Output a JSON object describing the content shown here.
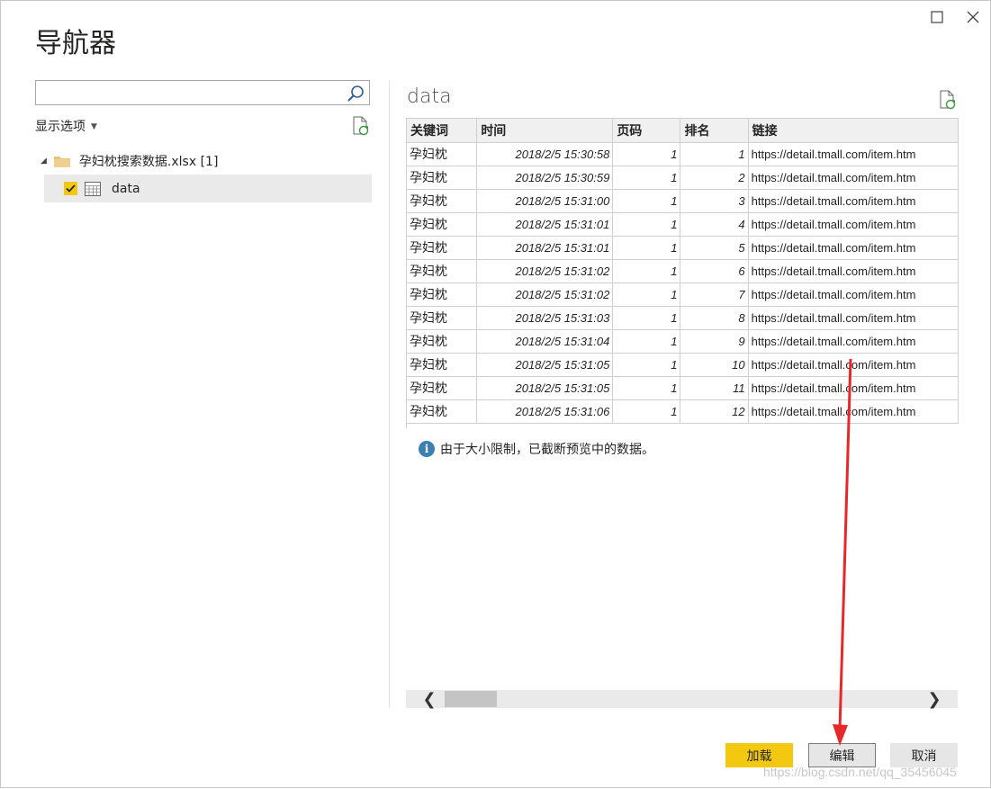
{
  "window": {
    "title": "导航器",
    "maximize_icon": "maximize-icon",
    "close_icon": "close-icon"
  },
  "left_panel": {
    "search": {
      "value": "",
      "placeholder": ""
    },
    "display_options_label": "显示选项",
    "tree": {
      "file_name": "孕妇枕搜索数据.xlsx [1]",
      "items": [
        {
          "label": "data",
          "checked": true
        }
      ]
    }
  },
  "preview": {
    "title": "data",
    "columns": [
      "关键词",
      "时间",
      "页码",
      "排名",
      "链接"
    ],
    "rows": [
      [
        "孕妇枕",
        "2018/2/5 15:30:58",
        "1",
        "1",
        "https://detail.tmall.com/item.htm"
      ],
      [
        "孕妇枕",
        "2018/2/5 15:30:59",
        "1",
        "2",
        "https://detail.tmall.com/item.htm"
      ],
      [
        "孕妇枕",
        "2018/2/5 15:31:00",
        "1",
        "3",
        "https://detail.tmall.com/item.htm"
      ],
      [
        "孕妇枕",
        "2018/2/5 15:31:01",
        "1",
        "4",
        "https://detail.tmall.com/item.htm"
      ],
      [
        "孕妇枕",
        "2018/2/5 15:31:01",
        "1",
        "5",
        "https://detail.tmall.com/item.htm"
      ],
      [
        "孕妇枕",
        "2018/2/5 15:31:02",
        "1",
        "6",
        "https://detail.tmall.com/item.htm"
      ],
      [
        "孕妇枕",
        "2018/2/5 15:31:02",
        "1",
        "7",
        "https://detail.tmall.com/item.htm"
      ],
      [
        "孕妇枕",
        "2018/2/5 15:31:03",
        "1",
        "8",
        "https://detail.tmall.com/item.htm"
      ],
      [
        "孕妇枕",
        "2018/2/5 15:31:04",
        "1",
        "9",
        "https://detail.tmall.com/item.htm"
      ],
      [
        "孕妇枕",
        "2018/2/5 15:31:05",
        "1",
        "10",
        "https://detail.tmall.com/item.htm"
      ],
      [
        "孕妇枕",
        "2018/2/5 15:31:05",
        "1",
        "11",
        "https://detail.tmall.com/item.htm"
      ],
      [
        "孕妇枕",
        "2018/2/5 15:31:06",
        "1",
        "12",
        "https://detail.tmall.com/item.htm"
      ]
    ],
    "info_message": "由于大小限制，已截断预览中的数据。"
  },
  "buttons": {
    "load": "加载",
    "edit": "编辑",
    "cancel": "取消"
  },
  "watermark": "https://blog.csdn.net/qq_35456045",
  "colors": {
    "accent": "#f2c811",
    "annotation_arrow": "#e8272a",
    "info": "#3c7fb1"
  }
}
